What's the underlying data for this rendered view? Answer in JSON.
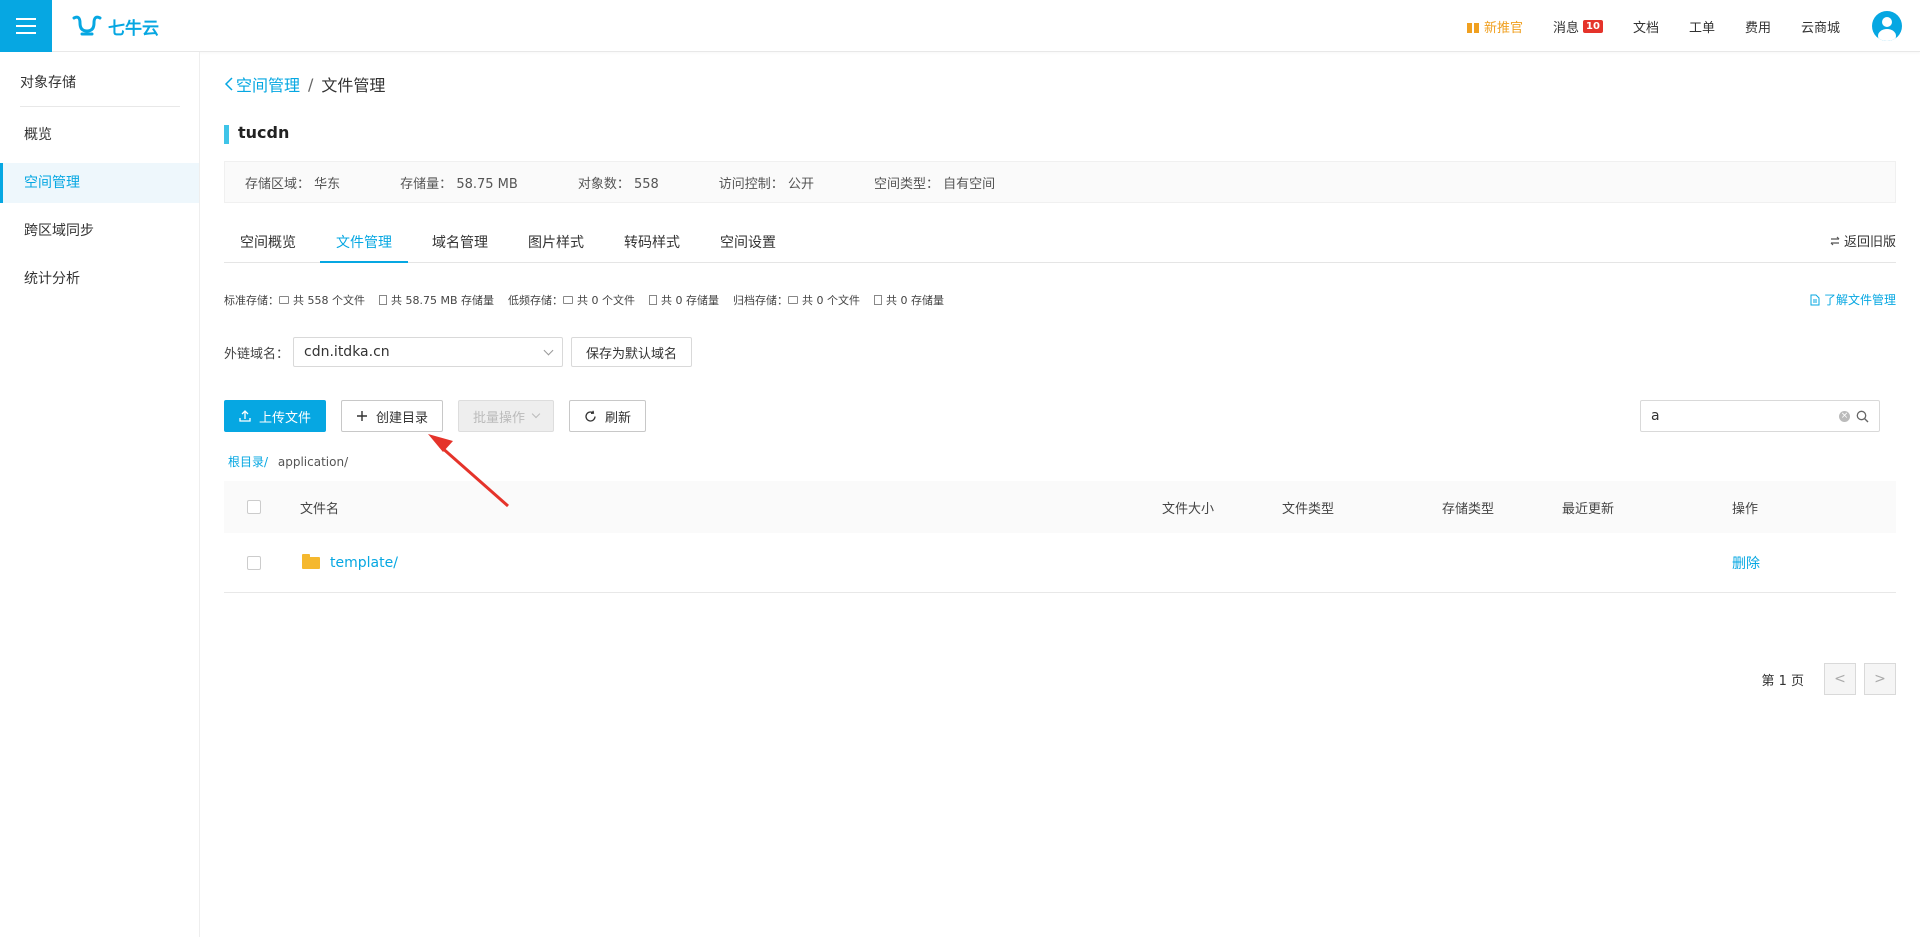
{
  "topbar": {
    "logo_text": "七牛云",
    "nav": [
      {
        "label": "新推官",
        "type": "promo"
      },
      {
        "label": "消息",
        "badge": "10"
      },
      {
        "label": "文档"
      },
      {
        "label": "工单"
      },
      {
        "label": "费用"
      },
      {
        "label": "云商城"
      }
    ]
  },
  "sidebar": {
    "title": "对象存储",
    "items": [
      {
        "label": "概览"
      },
      {
        "label": "空间管理",
        "active": true
      },
      {
        "label": "跨区域同步"
      },
      {
        "label": "统计分析"
      }
    ]
  },
  "breadcrumb": {
    "back": "空间管理",
    "sep": "/",
    "current": "文件管理"
  },
  "bucket": {
    "name": "tucdn"
  },
  "info": {
    "region_label": "存储区域：",
    "region": "华东",
    "size_label": "存储量：",
    "size": "58.75 MB",
    "objects_label": "对象数：",
    "objects": "558",
    "access_label": "访问控制：",
    "access": "公开",
    "type_label": "空间类型：",
    "type": "自有空间"
  },
  "tabs": [
    "空间概览",
    "文件管理",
    "域名管理",
    "图片样式",
    "转码样式",
    "空间设置"
  ],
  "back_old": "返回旧版",
  "stats": {
    "standard_label": "标准存储：",
    "standard_files": "共 558 个文件",
    "standard_size": "共 58.75 MB 存储量",
    "low_label": "低频存储：",
    "low_files": "共 0 个文件",
    "low_size": "共 0 存储量",
    "archive_label": "归档存储：",
    "archive_files": "共 0 个文件",
    "archive_size": "共 0 存储量"
  },
  "learn_link": "了解文件管理",
  "domain": {
    "label": "外链域名：",
    "value": "cdn.itdka.cn",
    "save_label": "保存为默认域名"
  },
  "toolbar": {
    "upload": "上传文件",
    "mkdir": "创建目录",
    "batch": "批量操作",
    "refresh": "刷新"
  },
  "search": {
    "value": "a"
  },
  "path": {
    "root": "根目录/",
    "current": "application/"
  },
  "table": {
    "headers": {
      "name": "文件名",
      "size": "文件大小",
      "type": "文件类型",
      "storage": "存储类型",
      "updated": "最近更新",
      "ops": "操作"
    },
    "rows": [
      {
        "name": "template/",
        "size": "",
        "type": "",
        "storage": "",
        "updated": "",
        "op": "删除"
      }
    ]
  },
  "pager": {
    "label": "第 1 页",
    "prev": "<",
    "next": ">"
  },
  "colors": {
    "accent": "#06a7e2",
    "promo": "#f0a020",
    "badge": "#e5332a",
    "folder": "#f5b82e"
  }
}
